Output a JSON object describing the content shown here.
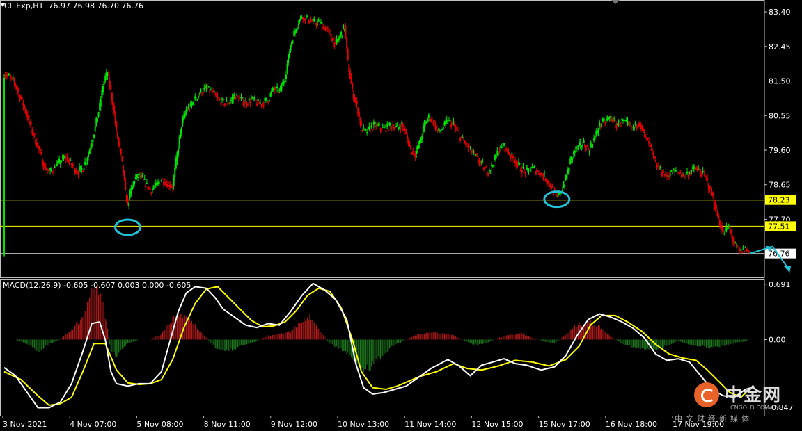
{
  "window": {
    "title": "CL.Exp,H1  76.97 76.98 76.70 76.76"
  },
  "indicator": {
    "label": "MACD(12,26,9) -0.605 -0.607 0.003 0.000 -0.605"
  },
  "watermark": {
    "name": "中金网",
    "url": "CNGOLD.COM.CN",
    "subtitle": "中文财经新媒体"
  },
  "colors": {
    "background": "#000000",
    "bull_candle": "#00e600",
    "bear_candle": "#e60000",
    "level_line": "#ffff00",
    "price_line": "#c0c0c0",
    "macd_line": "#ffffff",
    "signal_line": "#ffff00",
    "hist_up": "#b81c1c",
    "hist_down": "#1f7a1f",
    "annotation": "#22c1d6",
    "axis": "#c0c0c0"
  },
  "chart_data": {
    "type": "candlestick",
    "symbol": "CL.Exp",
    "timeframe": "H1",
    "ohlc_last": {
      "open": 76.97,
      "high": 76.98,
      "low": 76.7,
      "close": 76.76
    },
    "price_axis": {
      "ylim": [
        76.18,
        83.65
      ],
      "ticks": [
        83.4,
        82.45,
        81.5,
        80.55,
        79.6,
        78.65,
        77.7
      ],
      "tick_labels": [
        "83.40",
        "82.45",
        "81.50",
        "80.55",
        "79.60",
        "78.65",
        "77.70"
      ]
    },
    "x_axis": {
      "labels": [
        "3 Nov 2021",
        "4 Nov 07:00",
        "5 Nov 08:00",
        "8 Nov 11:00",
        "9 Nov 12:00",
        "10 Nov 13:00",
        "11 Nov 14:00",
        "12 Nov 15:00",
        "15 Nov 17:00",
        "16 Nov 18:00",
        "17 Nov 19:00"
      ]
    },
    "horizontal_levels": [
      {
        "value": 78.23,
        "label": "78.23",
        "style": "support"
      },
      {
        "value": 77.51,
        "label": "77.51",
        "style": "support"
      },
      {
        "value": 76.76,
        "label": "76.76",
        "style": "current"
      }
    ],
    "price_path": [
      [
        0,
        81.7
      ],
      [
        5,
        81.6
      ],
      [
        10,
        81.4
      ],
      [
        15,
        81.0
      ],
      [
        20,
        80.6
      ],
      [
        25,
        80.1
      ],
      [
        30,
        79.7
      ],
      [
        35,
        79.2
      ],
      [
        40,
        79.0
      ],
      [
        45,
        79.1
      ],
      [
        50,
        79.3
      ],
      [
        55,
        79.4
      ],
      [
        60,
        79.2
      ],
      [
        65,
        79.0
      ],
      [
        70,
        79.1
      ],
      [
        75,
        79.5
      ],
      [
        80,
        80.1
      ],
      [
        85,
        80.8
      ],
      [
        88,
        81.4
      ],
      [
        90,
        81.6
      ],
      [
        92,
        81.7
      ],
      [
        95,
        81.2
      ],
      [
        97,
        80.8
      ],
      [
        100,
        80.1
      ],
      [
        103,
        79.6
      ],
      [
        106,
        79.0
      ],
      [
        108,
        78.4
      ],
      [
        110,
        78.1
      ],
      [
        113,
        78.5
      ],
      [
        116,
        78.8
      ],
      [
        120,
        78.9
      ],
      [
        125,
        78.7
      ],
      [
        130,
        78.5
      ],
      [
        135,
        78.6
      ],
      [
        140,
        78.8
      ],
      [
        145,
        78.7
      ],
      [
        150,
        78.6
      ],
      [
        154,
        79.5
      ],
      [
        158,
        80.3
      ],
      [
        162,
        80.7
      ],
      [
        166,
        80.8
      ],
      [
        170,
        81.0
      ],
      [
        175,
        81.2
      ],
      [
        180,
        81.3
      ],
      [
        185,
        81.2
      ],
      [
        190,
        81.0
      ],
      [
        195,
        80.9
      ],
      [
        200,
        80.9
      ],
      [
        205,
        81.1
      ],
      [
        210,
        81.0
      ],
      [
        215,
        80.9
      ],
      [
        220,
        81.0
      ],
      [
        225,
        80.9
      ],
      [
        230,
        80.9
      ],
      [
        235,
        81.0
      ],
      [
        240,
        81.3
      ],
      [
        245,
        81.2
      ],
      [
        250,
        81.6
      ],
      [
        255,
        82.5
      ],
      [
        260,
        83.0
      ],
      [
        265,
        83.3
      ],
      [
        270,
        83.2
      ],
      [
        275,
        83.1
      ],
      [
        280,
        83.1
      ],
      [
        285,
        83.0
      ],
      [
        290,
        82.8
      ],
      [
        295,
        82.5
      ],
      [
        300,
        82.8
      ],
      [
        303,
        83.0
      ],
      [
        306,
        82.0
      ],
      [
        310,
        81.2
      ],
      [
        314,
        80.8
      ],
      [
        318,
        80.2
      ],
      [
        322,
        80.1
      ],
      [
        326,
        80.2
      ],
      [
        330,
        80.3
      ],
      [
        335,
        80.2
      ],
      [
        340,
        80.2
      ],
      [
        345,
        80.3
      ],
      [
        350,
        80.2
      ],
      [
        354,
        80.3
      ],
      [
        358,
        80.0
      ],
      [
        362,
        79.6
      ],
      [
        366,
        79.5
      ],
      [
        370,
        79.8
      ],
      [
        374,
        80.3
      ],
      [
        378,
        80.5
      ],
      [
        382,
        80.4
      ],
      [
        386,
        80.1
      ],
      [
        390,
        80.2
      ],
      [
        395,
        80.4
      ],
      [
        400,
        80.3
      ],
      [
        405,
        80.0
      ],
      [
        410,
        79.8
      ],
      [
        415,
        79.6
      ],
      [
        420,
        79.4
      ],
      [
        425,
        79.2
      ],
      [
        430,
        79.0
      ],
      [
        435,
        79.2
      ],
      [
        440,
        79.6
      ],
      [
        445,
        79.7
      ],
      [
        450,
        79.5
      ],
      [
        455,
        79.3
      ],
      [
        460,
        79.1
      ],
      [
        465,
        79.0
      ],
      [
        470,
        79.1
      ],
      [
        475,
        79.0
      ],
      [
        480,
        78.9
      ],
      [
        485,
        78.7
      ],
      [
        488,
        78.5
      ],
      [
        492,
        78.3
      ],
      [
        496,
        78.5
      ],
      [
        500,
        78.8
      ],
      [
        504,
        79.3
      ],
      [
        508,
        79.6
      ],
      [
        512,
        79.7
      ],
      [
        516,
        79.8
      ],
      [
        520,
        79.6
      ],
      [
        525,
        79.9
      ],
      [
        530,
        80.3
      ],
      [
        535,
        80.4
      ],
      [
        540,
        80.5
      ],
      [
        545,
        80.3
      ],
      [
        550,
        80.4
      ],
      [
        555,
        80.3
      ],
      [
        560,
        80.2
      ],
      [
        565,
        80.4
      ],
      [
        570,
        80.0
      ],
      [
        575,
        79.7
      ],
      [
        580,
        79.2
      ],
      [
        585,
        79.0
      ],
      [
        590,
        78.9
      ],
      [
        595,
        79.0
      ],
      [
        600,
        79.0
      ],
      [
        605,
        78.9
      ],
      [
        610,
        79.0
      ],
      [
        615,
        79.1
      ],
      [
        620,
        79.0
      ],
      [
        625,
        78.8
      ],
      [
        630,
        78.4
      ],
      [
        635,
        77.8
      ],
      [
        640,
        77.3
      ],
      [
        645,
        77.5
      ],
      [
        650,
        77.0
      ],
      [
        655,
        76.8
      ],
      [
        660,
        76.9
      ],
      [
        664,
        76.76
      ]
    ],
    "macd_panel": {
      "ylim": [
        -0.95,
        0.75
      ],
      "ticks": [
        0.691,
        0.0,
        -0.847
      ],
      "tick_labels": [
        "0.691",
        "0.00",
        "-0.847"
      ],
      "macd": [
        [
          0,
          -0.35
        ],
        [
          10,
          -0.45
        ],
        [
          20,
          -0.65
        ],
        [
          30,
          -0.85
        ],
        [
          40,
          -0.85
        ],
        [
          50,
          -0.78
        ],
        [
          60,
          -0.55
        ],
        [
          70,
          -0.15
        ],
        [
          78,
          0.2
        ],
        [
          85,
          0.22
        ],
        [
          90,
          0.0
        ],
        [
          95,
          -0.4
        ],
        [
          100,
          -0.55
        ],
        [
          110,
          -0.58
        ],
        [
          120,
          -0.55
        ],
        [
          130,
          -0.55
        ],
        [
          140,
          -0.4
        ],
        [
          148,
          0.0
        ],
        [
          155,
          0.35
        ],
        [
          162,
          0.58
        ],
        [
          170,
          0.66
        ],
        [
          180,
          0.64
        ],
        [
          188,
          0.52
        ],
        [
          195,
          0.38
        ],
        [
          205,
          0.28
        ],
        [
          215,
          0.18
        ],
        [
          225,
          0.15
        ],
        [
          235,
          0.2
        ],
        [
          245,
          0.18
        ],
        [
          255,
          0.35
        ],
        [
          265,
          0.55
        ],
        [
          275,
          0.7
        ],
        [
          285,
          0.62
        ],
        [
          295,
          0.5
        ],
        [
          305,
          0.25
        ],
        [
          313,
          -0.3
        ],
        [
          320,
          -0.6
        ],
        [
          328,
          -0.68
        ],
        [
          338,
          -0.66
        ],
        [
          348,
          -0.62
        ],
        [
          358,
          -0.58
        ],
        [
          368,
          -0.48
        ],
        [
          380,
          -0.36
        ],
        [
          395,
          -0.25
        ],
        [
          405,
          -0.33
        ],
        [
          415,
          -0.45
        ],
        [
          425,
          -0.32
        ],
        [
          435,
          -0.28
        ],
        [
          445,
          -0.24
        ],
        [
          455,
          -0.3
        ],
        [
          465,
          -0.32
        ],
        [
          478,
          -0.38
        ],
        [
          490,
          -0.34
        ],
        [
          500,
          -0.2
        ],
        [
          510,
          0.05
        ],
        [
          520,
          0.25
        ],
        [
          530,
          0.32
        ],
        [
          540,
          0.28
        ],
        [
          550,
          0.22
        ],
        [
          560,
          0.14
        ],
        [
          570,
          0.02
        ],
        [
          580,
          -0.18
        ],
        [
          590,
          -0.26
        ],
        [
          600,
          -0.24
        ],
        [
          610,
          -0.28
        ],
        [
          620,
          -0.45
        ],
        [
          630,
          -0.62
        ],
        [
          640,
          -0.7
        ],
        [
          650,
          -0.72
        ],
        [
          660,
          -0.62
        ],
        [
          664,
          -0.605
        ]
      ],
      "signal": [
        [
          0,
          -0.4
        ],
        [
          15,
          -0.5
        ],
        [
          30,
          -0.7
        ],
        [
          40,
          -0.82
        ],
        [
          50,
          -0.8
        ],
        [
          60,
          -0.72
        ],
        [
          70,
          -0.4
        ],
        [
          80,
          -0.05
        ],
        [
          90,
          -0.05
        ],
        [
          100,
          -0.38
        ],
        [
          110,
          -0.54
        ],
        [
          120,
          -0.56
        ],
        [
          130,
          -0.55
        ],
        [
          140,
          -0.5
        ],
        [
          150,
          -0.25
        ],
        [
          160,
          0.15
        ],
        [
          170,
          0.45
        ],
        [
          180,
          0.63
        ],
        [
          190,
          0.66
        ],
        [
          200,
          0.52
        ],
        [
          210,
          0.38
        ],
        [
          220,
          0.24
        ],
        [
          230,
          0.16
        ],
        [
          240,
          0.17
        ],
        [
          250,
          0.22
        ],
        [
          260,
          0.36
        ],
        [
          270,
          0.55
        ],
        [
          280,
          0.64
        ],
        [
          290,
          0.6
        ],
        [
          300,
          0.4
        ],
        [
          310,
          0.0
        ],
        [
          318,
          -0.4
        ],
        [
          328,
          -0.6
        ],
        [
          340,
          -0.62
        ],
        [
          350,
          -0.58
        ],
        [
          360,
          -0.52
        ],
        [
          370,
          -0.46
        ],
        [
          385,
          -0.4
        ],
        [
          400,
          -0.3
        ],
        [
          412,
          -0.36
        ],
        [
          425,
          -0.38
        ],
        [
          440,
          -0.33
        ],
        [
          455,
          -0.26
        ],
        [
          470,
          -0.28
        ],
        [
          485,
          -0.33
        ],
        [
          500,
          -0.25
        ],
        [
          512,
          -0.08
        ],
        [
          522,
          0.18
        ],
        [
          532,
          0.3
        ],
        [
          544,
          0.3
        ],
        [
          555,
          0.22
        ],
        [
          568,
          0.1
        ],
        [
          580,
          -0.06
        ],
        [
          592,
          -0.18
        ],
        [
          604,
          -0.23
        ],
        [
          616,
          -0.26
        ],
        [
          626,
          -0.38
        ],
        [
          636,
          -0.52
        ],
        [
          646,
          -0.66
        ],
        [
          656,
          -0.72
        ],
        [
          664,
          -0.607
        ]
      ],
      "histogram_sampled_every_bar": true,
      "histogram": [
        [
          0,
          0.0
        ],
        [
          10,
          0.0
        ],
        [
          20,
          -0.05
        ],
        [
          30,
          -0.15
        ],
        [
          40,
          -0.06
        ],
        [
          50,
          0.0
        ],
        [
          60,
          0.12
        ],
        [
          70,
          0.28
        ],
        [
          78,
          0.58
        ],
        [
          84,
          0.63
        ],
        [
          90,
          0.3
        ],
        [
          95,
          -0.15
        ],
        [
          100,
          -0.2
        ],
        [
          110,
          -0.05
        ],
        [
          120,
          0.0
        ],
        [
          130,
          0.0
        ],
        [
          140,
          0.07
        ],
        [
          148,
          0.22
        ],
        [
          155,
          0.32
        ],
        [
          162,
          0.28
        ],
        [
          170,
          0.18
        ],
        [
          180,
          0.02
        ],
        [
          188,
          -0.1
        ],
        [
          195,
          -0.14
        ],
        [
          205,
          -0.12
        ],
        [
          215,
          -0.06
        ],
        [
          225,
          -0.02
        ],
        [
          235,
          0.05
        ],
        [
          245,
          0.07
        ],
        [
          255,
          0.1
        ],
        [
          265,
          0.22
        ],
        [
          272,
          0.3
        ],
        [
          280,
          0.12
        ],
        [
          290,
          -0.05
        ],
        [
          300,
          -0.12
        ],
        [
          310,
          -0.22
        ],
        [
          318,
          -0.36
        ],
        [
          326,
          -0.34
        ],
        [
          336,
          -0.2
        ],
        [
          346,
          -0.08
        ],
        [
          358,
          0.0
        ],
        [
          368,
          0.06
        ],
        [
          378,
          0.09
        ],
        [
          388,
          0.08
        ],
        [
          398,
          0.06
        ],
        [
          408,
          0.0
        ],
        [
          418,
          -0.06
        ],
        [
          428,
          -0.05
        ],
        [
          440,
          0.02
        ],
        [
          450,
          0.06
        ],
        [
          460,
          0.08
        ],
        [
          470,
          0.02
        ],
        [
          480,
          -0.02
        ],
        [
          490,
          -0.05
        ],
        [
          500,
          0.06
        ],
        [
          510,
          0.18
        ],
        [
          520,
          0.22
        ],
        [
          530,
          0.16
        ],
        [
          540,
          0.04
        ],
        [
          550,
          -0.05
        ],
        [
          560,
          -0.1
        ],
        [
          570,
          -0.12
        ],
        [
          580,
          -0.12
        ],
        [
          590,
          -0.08
        ],
        [
          600,
          -0.02
        ],
        [
          610,
          -0.06
        ],
        [
          620,
          -0.08
        ],
        [
          630,
          -0.1
        ],
        [
          640,
          -0.08
        ],
        [
          650,
          -0.04
        ],
        [
          660,
          -0.02
        ],
        [
          664,
          0.003
        ]
      ]
    },
    "annotations": [
      {
        "type": "ellipse",
        "bar": 110,
        "price": 77.48,
        "label": ""
      },
      {
        "type": "ellipse",
        "bar": 492,
        "price": 78.25,
        "label": ""
      },
      {
        "type": "arrow-path",
        "points": [
          [
            664,
            76.76
          ],
          [
            684,
            76.95
          ],
          [
            698,
            76.35
          ]
        ]
      }
    ],
    "total_bars": 700
  }
}
